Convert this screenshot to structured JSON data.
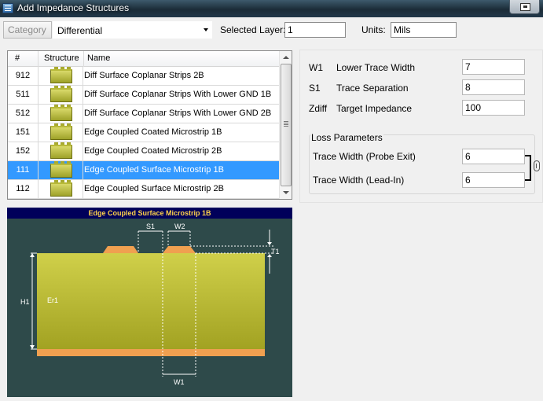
{
  "window": {
    "title": "Add Impedance Structures"
  },
  "filter": {
    "category_label": "Category",
    "type_value": "Differential",
    "selected_layer_label": "Selected Layer:",
    "selected_layer_value": "1",
    "units_label": "Units:",
    "units_value": "Mils"
  },
  "table": {
    "columns": [
      "#",
      "Structure",
      "Name"
    ],
    "rows": [
      {
        "num": "912",
        "name": "Diff Surface Coplanar Strips 2B",
        "selected": false
      },
      {
        "num": "511",
        "name": "Diff Surface Coplanar Strips With Lower GND 1B",
        "selected": false
      },
      {
        "num": "512",
        "name": "Diff Surface Coplanar Strips With Lower GND 2B",
        "selected": false
      },
      {
        "num": "151",
        "name": "Edge Coupled Coated Microstrip 1B",
        "selected": false
      },
      {
        "num": "152",
        "name": "Edge Coupled Coated Microstrip 2B",
        "selected": false
      },
      {
        "num": "111",
        "name": "Edge Coupled Surface Microstrip 1B",
        "selected": true
      },
      {
        "num": "112",
        "name": "Edge Coupled Surface Microstrip 2B",
        "selected": false
      }
    ]
  },
  "diagram": {
    "title": "Edge Coupled Surface Microstrip 1B",
    "labels": {
      "s1": "S1",
      "w2": "W2",
      "t1": "T1",
      "h1": "H1",
      "er1": "Er1",
      "w1": "W1"
    },
    "colors": {
      "background": "#2e4a4a",
      "dielectric": "#c8c83c",
      "trace": "#f0a050",
      "title_bar": "#00005a",
      "title_text": "#ffd24a"
    }
  },
  "params": {
    "w1": {
      "abbr": "W1",
      "label": "Lower Trace Width",
      "value": "7"
    },
    "s1": {
      "abbr": "S1",
      "label": "Trace Separation",
      "value": "8"
    },
    "zdiff": {
      "abbr": "Zdiff",
      "label": "Target Impedance",
      "value": "100"
    },
    "loss": {
      "title": "Loss Parameters",
      "probe_exit": {
        "label": "Trace Width (Probe Exit)",
        "value": "6"
      },
      "lead_in": {
        "label": "Trace Width (Lead-In)",
        "value": "6"
      }
    }
  },
  "icons": {
    "app": "app-window-icon",
    "restore": "restore-window-icon",
    "link": "link-icon"
  },
  "colors": {
    "selection": "#3399ff",
    "titlebar": "#1b2c38"
  }
}
